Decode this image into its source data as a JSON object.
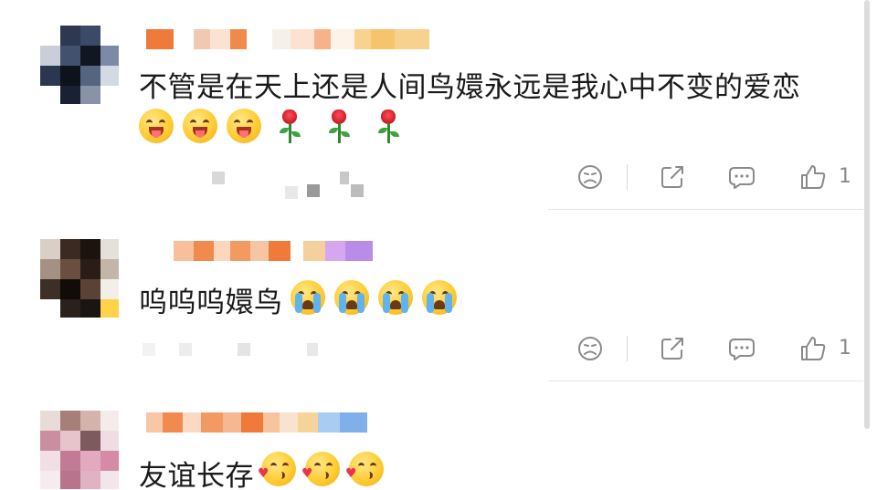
{
  "comments": [
    {
      "text": "不管是在天上还是人间鸟嬛永远是我心中不变的爱恋",
      "emojis": [
        "tongue-face",
        "tongue-face",
        "tongue-face",
        "rose",
        "rose",
        "rose"
      ],
      "like_count": "1"
    },
    {
      "text": "呜呜呜嬛鸟",
      "emojis": [
        "crying-face",
        "crying-face",
        "crying-face",
        "crying-face"
      ],
      "like_count": "1"
    },
    {
      "text": "友谊长存",
      "emojis": [
        "kissing-heart-face",
        "kissing-heart-face",
        "kissing-heart-face"
      ]
    }
  ],
  "actions": {
    "icons": [
      "dislike-icon",
      "share-icon",
      "reply-icon",
      "like-icon"
    ]
  },
  "colors": {
    "text": "#1a1a1a",
    "icon_gray": "#8a8a8a",
    "divider": "#e6e6e6",
    "background": "#ffffff"
  }
}
